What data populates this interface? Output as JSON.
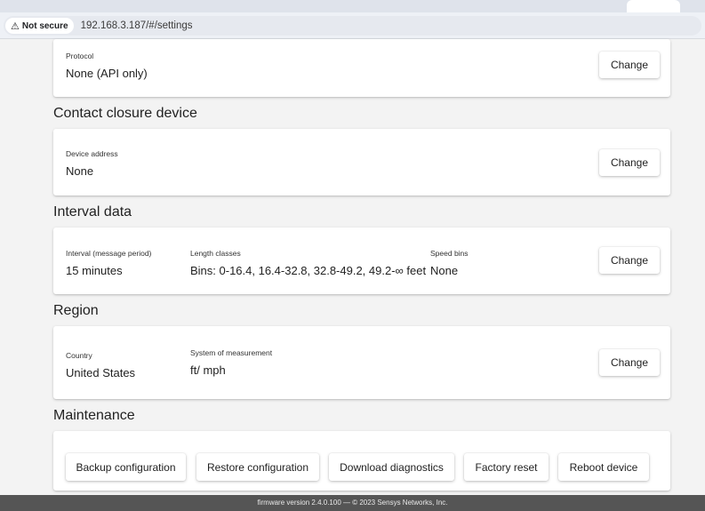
{
  "browser": {
    "security_label": "Not secure",
    "url": "192.168.3.187/#/settings"
  },
  "protocol_card": {
    "label": "Protocol",
    "value": "None (API only)",
    "change_label": "Change"
  },
  "contact_closure": {
    "title": "Contact closure device",
    "label": "Device address",
    "value": "None",
    "change_label": "Change"
  },
  "interval_data": {
    "title": "Interval data",
    "interval_label": "Interval (message period)",
    "interval_value": "15 minutes",
    "length_label": "Length classes",
    "length_value": "Bins: 0-16.4, 16.4-32.8, 32.8-49.2, 49.2-∞ feet",
    "speed_label": "Speed bins",
    "speed_value": "None",
    "change_label": "Change"
  },
  "region": {
    "title": "Region",
    "country_label": "Country",
    "country_value": "United States",
    "measurement_label": "System of measurement",
    "measurement_value": "ft/ mph",
    "change_label": "Change"
  },
  "maintenance": {
    "title": "Maintenance",
    "backup_label": "Backup configuration",
    "restore_label": "Restore configuration",
    "diagnostics_label": "Download diagnostics",
    "factory_reset_label": "Factory reset",
    "reboot_label": "Reboot device"
  },
  "footer": {
    "text": "firmware version 2.4.0.100 — © 2023 Sensys Networks, Inc."
  }
}
